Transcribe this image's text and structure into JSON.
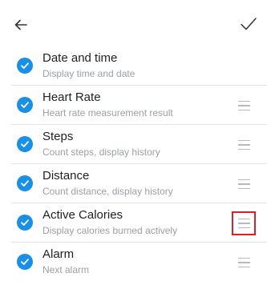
{
  "header": {
    "back_icon": "arrow-left-icon",
    "confirm_icon": "checkmark-icon"
  },
  "colors": {
    "accent": "#1a8fe6",
    "highlight": "#d6202a"
  },
  "items": [
    {
      "title": "Date and time",
      "subtitle": "Display time and date",
      "checked": true,
      "draggable": false
    },
    {
      "title": "Heart Rate",
      "subtitle": "Heart rate measurement result",
      "checked": true,
      "draggable": true
    },
    {
      "title": "Steps",
      "subtitle": "Count steps, display history",
      "checked": true,
      "draggable": true
    },
    {
      "title": "Distance",
      "subtitle": "Count distance, display history",
      "checked": true,
      "draggable": true
    },
    {
      "title": "Active Calories",
      "subtitle": "Display calories burned actively",
      "checked": true,
      "draggable": true,
      "highlighted": true
    },
    {
      "title": "Alarm",
      "subtitle": "Next alarm",
      "checked": true,
      "draggable": true
    }
  ]
}
